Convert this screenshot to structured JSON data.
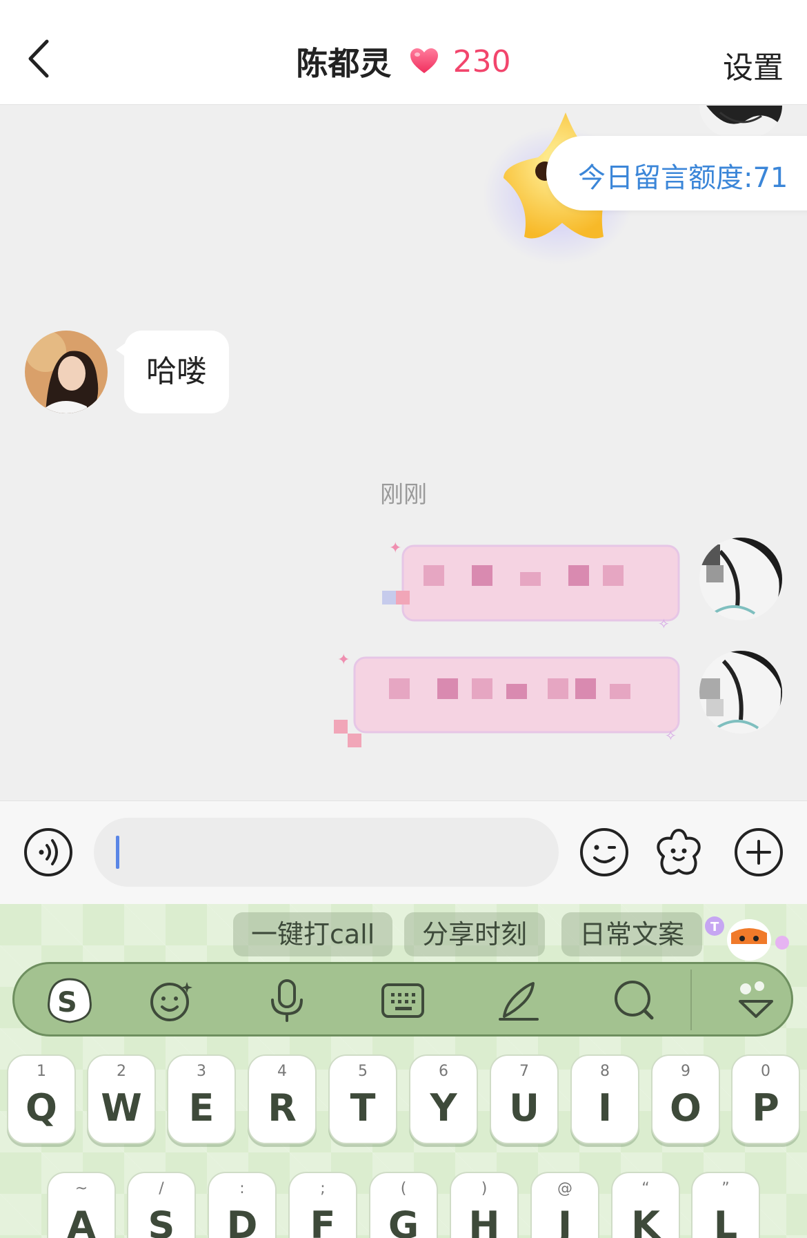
{
  "header": {
    "contact_name": "陈都灵",
    "intimacy_score": "230",
    "settings_label": "设置"
  },
  "chat": {
    "quota_text": "今日留言额度:71",
    "received_message": "哈喽",
    "timestamp": "刚刚"
  },
  "input": {
    "placeholder": ""
  },
  "keyboard": {
    "chips": [
      "一键打call",
      "分享时刻",
      "日常文案"
    ],
    "row1": [
      {
        "letter": "Q",
        "sub": "1"
      },
      {
        "letter": "W",
        "sub": "2"
      },
      {
        "letter": "E",
        "sub": "3"
      },
      {
        "letter": "R",
        "sub": "4"
      },
      {
        "letter": "T",
        "sub": "5"
      },
      {
        "letter": "Y",
        "sub": "6"
      },
      {
        "letter": "U",
        "sub": "7"
      },
      {
        "letter": "I",
        "sub": "8"
      },
      {
        "letter": "O",
        "sub": "9"
      },
      {
        "letter": "P",
        "sub": "0"
      }
    ],
    "row2": [
      {
        "letter": "A",
        "sub": "~"
      },
      {
        "letter": "S",
        "sub": "/"
      },
      {
        "letter": "D",
        "sub": ":"
      },
      {
        "letter": "F",
        "sub": ";"
      },
      {
        "letter": "G",
        "sub": "("
      },
      {
        "letter": "H",
        "sub": ")"
      },
      {
        "letter": "J",
        "sub": "@"
      },
      {
        "letter": "K",
        "sub": "“"
      },
      {
        "letter": "L",
        "sub": "”"
      }
    ]
  },
  "colors": {
    "accent_pink": "#f2456c",
    "quota_blue": "#3b86d8",
    "keyboard_green": "#a3c290"
  }
}
